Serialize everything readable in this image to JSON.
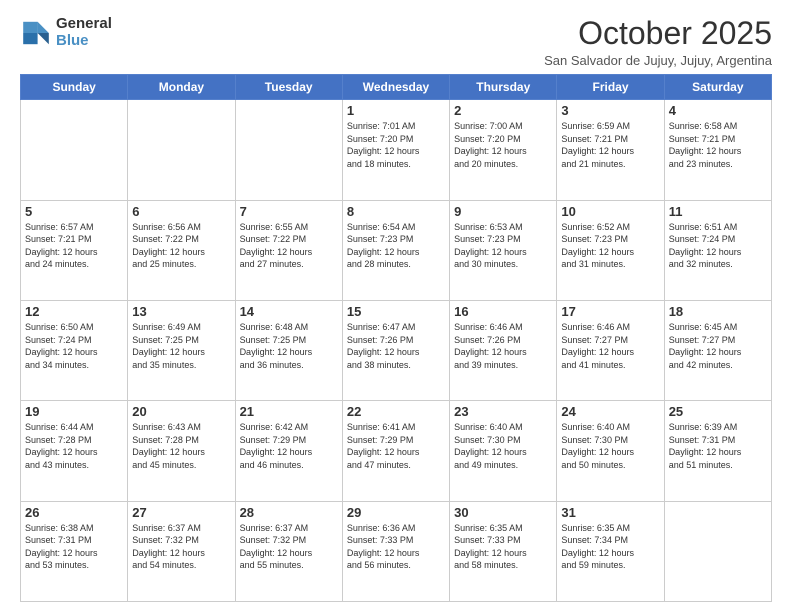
{
  "logo": {
    "line1": "General",
    "line2": "Blue"
  },
  "title": "October 2025",
  "subtitle": "San Salvador de Jujuy, Jujuy, Argentina",
  "days_of_week": [
    "Sunday",
    "Monday",
    "Tuesday",
    "Wednesday",
    "Thursday",
    "Friday",
    "Saturday"
  ],
  "weeks": [
    [
      {
        "day": "",
        "info": ""
      },
      {
        "day": "",
        "info": ""
      },
      {
        "day": "",
        "info": ""
      },
      {
        "day": "1",
        "info": "Sunrise: 7:01 AM\nSunset: 7:20 PM\nDaylight: 12 hours\nand 18 minutes."
      },
      {
        "day": "2",
        "info": "Sunrise: 7:00 AM\nSunset: 7:20 PM\nDaylight: 12 hours\nand 20 minutes."
      },
      {
        "day": "3",
        "info": "Sunrise: 6:59 AM\nSunset: 7:21 PM\nDaylight: 12 hours\nand 21 minutes."
      },
      {
        "day": "4",
        "info": "Sunrise: 6:58 AM\nSunset: 7:21 PM\nDaylight: 12 hours\nand 23 minutes."
      }
    ],
    [
      {
        "day": "5",
        "info": "Sunrise: 6:57 AM\nSunset: 7:21 PM\nDaylight: 12 hours\nand 24 minutes."
      },
      {
        "day": "6",
        "info": "Sunrise: 6:56 AM\nSunset: 7:22 PM\nDaylight: 12 hours\nand 25 minutes."
      },
      {
        "day": "7",
        "info": "Sunrise: 6:55 AM\nSunset: 7:22 PM\nDaylight: 12 hours\nand 27 minutes."
      },
      {
        "day": "8",
        "info": "Sunrise: 6:54 AM\nSunset: 7:23 PM\nDaylight: 12 hours\nand 28 minutes."
      },
      {
        "day": "9",
        "info": "Sunrise: 6:53 AM\nSunset: 7:23 PM\nDaylight: 12 hours\nand 30 minutes."
      },
      {
        "day": "10",
        "info": "Sunrise: 6:52 AM\nSunset: 7:23 PM\nDaylight: 12 hours\nand 31 minutes."
      },
      {
        "day": "11",
        "info": "Sunrise: 6:51 AM\nSunset: 7:24 PM\nDaylight: 12 hours\nand 32 minutes."
      }
    ],
    [
      {
        "day": "12",
        "info": "Sunrise: 6:50 AM\nSunset: 7:24 PM\nDaylight: 12 hours\nand 34 minutes."
      },
      {
        "day": "13",
        "info": "Sunrise: 6:49 AM\nSunset: 7:25 PM\nDaylight: 12 hours\nand 35 minutes."
      },
      {
        "day": "14",
        "info": "Sunrise: 6:48 AM\nSunset: 7:25 PM\nDaylight: 12 hours\nand 36 minutes."
      },
      {
        "day": "15",
        "info": "Sunrise: 6:47 AM\nSunset: 7:26 PM\nDaylight: 12 hours\nand 38 minutes."
      },
      {
        "day": "16",
        "info": "Sunrise: 6:46 AM\nSunset: 7:26 PM\nDaylight: 12 hours\nand 39 minutes."
      },
      {
        "day": "17",
        "info": "Sunrise: 6:46 AM\nSunset: 7:27 PM\nDaylight: 12 hours\nand 41 minutes."
      },
      {
        "day": "18",
        "info": "Sunrise: 6:45 AM\nSunset: 7:27 PM\nDaylight: 12 hours\nand 42 minutes."
      }
    ],
    [
      {
        "day": "19",
        "info": "Sunrise: 6:44 AM\nSunset: 7:28 PM\nDaylight: 12 hours\nand 43 minutes."
      },
      {
        "day": "20",
        "info": "Sunrise: 6:43 AM\nSunset: 7:28 PM\nDaylight: 12 hours\nand 45 minutes."
      },
      {
        "day": "21",
        "info": "Sunrise: 6:42 AM\nSunset: 7:29 PM\nDaylight: 12 hours\nand 46 minutes."
      },
      {
        "day": "22",
        "info": "Sunrise: 6:41 AM\nSunset: 7:29 PM\nDaylight: 12 hours\nand 47 minutes."
      },
      {
        "day": "23",
        "info": "Sunrise: 6:40 AM\nSunset: 7:30 PM\nDaylight: 12 hours\nand 49 minutes."
      },
      {
        "day": "24",
        "info": "Sunrise: 6:40 AM\nSunset: 7:30 PM\nDaylight: 12 hours\nand 50 minutes."
      },
      {
        "day": "25",
        "info": "Sunrise: 6:39 AM\nSunset: 7:31 PM\nDaylight: 12 hours\nand 51 minutes."
      }
    ],
    [
      {
        "day": "26",
        "info": "Sunrise: 6:38 AM\nSunset: 7:31 PM\nDaylight: 12 hours\nand 53 minutes."
      },
      {
        "day": "27",
        "info": "Sunrise: 6:37 AM\nSunset: 7:32 PM\nDaylight: 12 hours\nand 54 minutes."
      },
      {
        "day": "28",
        "info": "Sunrise: 6:37 AM\nSunset: 7:32 PM\nDaylight: 12 hours\nand 55 minutes."
      },
      {
        "day": "29",
        "info": "Sunrise: 6:36 AM\nSunset: 7:33 PM\nDaylight: 12 hours\nand 56 minutes."
      },
      {
        "day": "30",
        "info": "Sunrise: 6:35 AM\nSunset: 7:33 PM\nDaylight: 12 hours\nand 58 minutes."
      },
      {
        "day": "31",
        "info": "Sunrise: 6:35 AM\nSunset: 7:34 PM\nDaylight: 12 hours\nand 59 minutes."
      },
      {
        "day": "",
        "info": ""
      }
    ]
  ]
}
